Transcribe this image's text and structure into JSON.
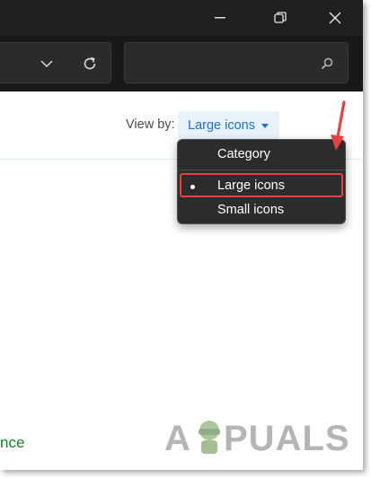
{
  "window": {
    "controls": [
      "minimize-icon",
      "restore-icon",
      "close-icon"
    ]
  },
  "address_bar": {
    "dropdown_icon": "chevron-down-icon",
    "refresh_icon": "refresh-icon",
    "search_icon": "search-icon"
  },
  "view_by": {
    "label": "View by:",
    "selected": "Large icons",
    "options": [
      "Category",
      "Large icons",
      "Small icons"
    ],
    "selected_index": 1
  },
  "link": {
    "text": "nce"
  },
  "watermark": {
    "text": "APPUALS"
  },
  "colors": {
    "titlebar": "#202020",
    "menu_bg": "#2c2c2c",
    "highlight": "#e8413f",
    "link": "#1a7f2e",
    "select_text": "#1e6fc8"
  }
}
